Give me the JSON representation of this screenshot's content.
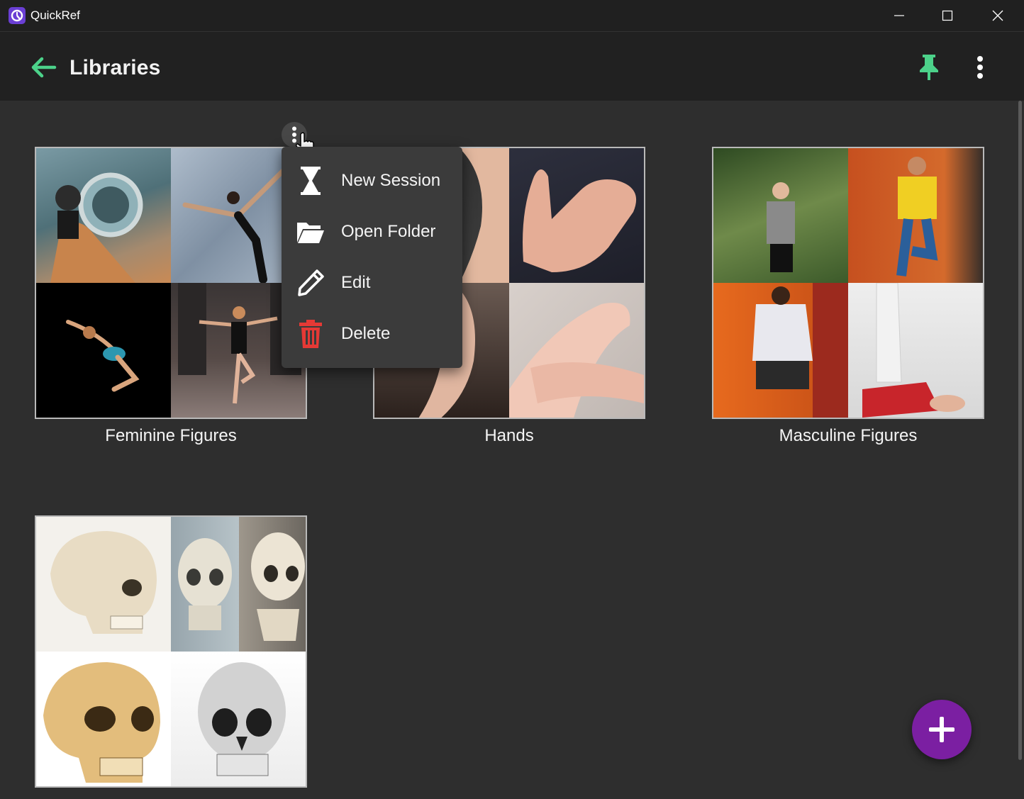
{
  "window": {
    "app_title": "QuickRef",
    "controls": {
      "minimize": "minimize-icon",
      "maximize": "maximize-icon",
      "close": "close-icon"
    }
  },
  "header": {
    "title": "Libraries",
    "back_icon": "arrow-back-icon",
    "pin_icon": "pin-icon",
    "more_icon": "more-vert-icon"
  },
  "colors": {
    "accent_green": "#4cd28a",
    "fab_purple": "#7b1fa2",
    "delete_red": "#e53935",
    "background": "#2e2e2e",
    "appbar": "#212121",
    "menu": "#3b3b3b"
  },
  "libraries": [
    {
      "name": "Feminine Figures"
    },
    {
      "name": "Hands"
    },
    {
      "name": "Masculine Figures"
    },
    {
      "name": "Skulls",
      "label_visible": false
    }
  ],
  "context_menu": {
    "items": [
      {
        "label": "New Session",
        "icon": "hourglass-icon"
      },
      {
        "label": "Open Folder",
        "icon": "folder-open-icon"
      },
      {
        "label": "Edit",
        "icon": "pencil-icon"
      },
      {
        "label": "Delete",
        "icon": "trash-icon"
      }
    ]
  },
  "fab": {
    "icon": "plus-icon"
  }
}
